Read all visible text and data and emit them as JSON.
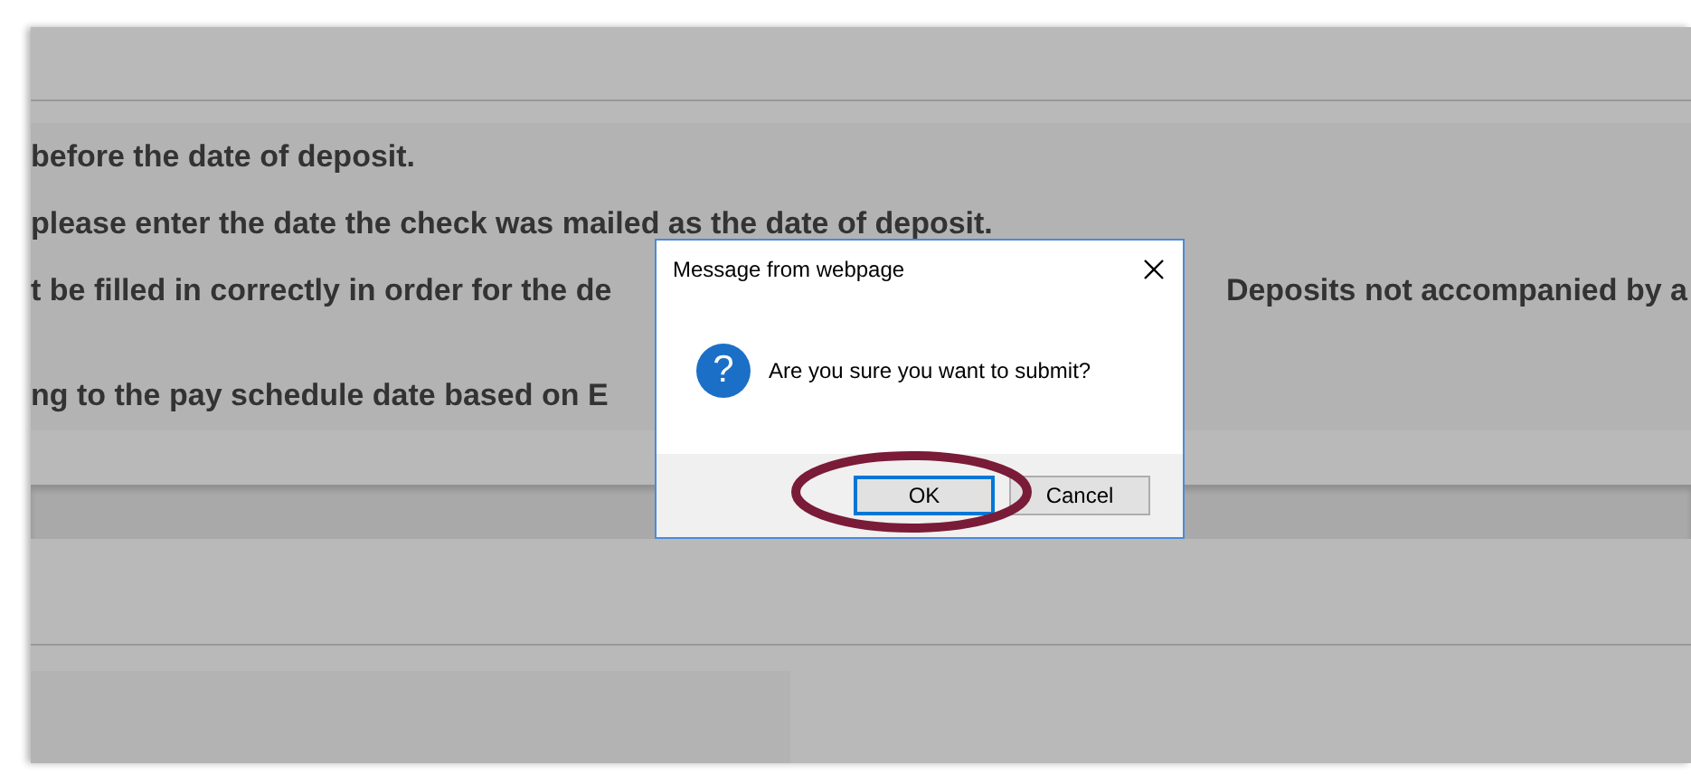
{
  "page": {
    "lines": [
      {
        "segments": [
          "before the date of deposit."
        ]
      },
      {
        "segments": [
          "please enter the date the check was mailed as the date of deposit."
        ]
      },
      {
        "segments": [
          "t be filled in correctly in order for the de",
          "Deposits not accompanied by a"
        ]
      },
      {
        "segments": [
          "ng to the pay schedule date based on E"
        ]
      }
    ]
  },
  "dialog": {
    "title": "Message from webpage",
    "icon": "?",
    "message": "Are you sure you want to submit?",
    "buttons": [
      {
        "label": "OK",
        "selected": true
      },
      {
        "label": "Cancel",
        "selected": false
      }
    ]
  }
}
